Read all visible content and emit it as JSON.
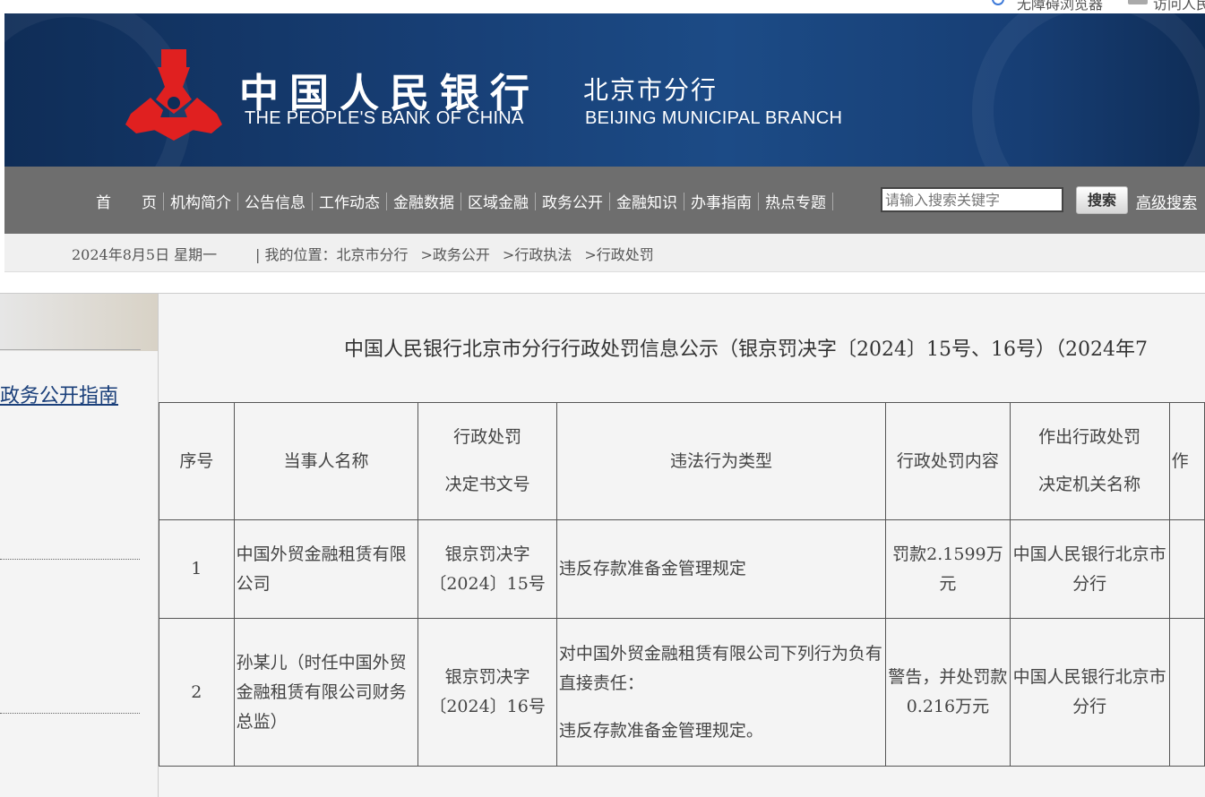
{
  "topbar": {
    "accessibility_browser": "无障碍浏览器",
    "visit_link": "访问人民"
  },
  "header": {
    "cn_name": "中国人民银行",
    "en_name": "THE PEOPLE'S BANK OF CHINA",
    "branch_cn": "北京市分行",
    "branch_en": "BEIJING MUNICIPAL  BRANCH",
    "logo_color": "#e02020"
  },
  "nav": {
    "items": [
      "首　　页",
      "机构简介",
      "公告信息",
      "工作动态",
      "金融数据",
      "区域金融",
      "政务公开",
      "金融知识",
      "办事指南",
      "热点专题"
    ],
    "search_placeholder": "请输入搜索关键字",
    "search_button": "搜索",
    "advanced_search": "高级搜索"
  },
  "breadcrumb": {
    "date": "2024年8月5日  星期一",
    "prefix": "| 我的位置：",
    "items": [
      "北京市分行",
      "政务公开",
      "行政执法",
      "行政处罚"
    ],
    "separator": ">"
  },
  "sidebar": {
    "guide_link": "政务公开指南"
  },
  "content": {
    "title": "中国人民银行北京市分行行政处罚信息公示（银京罚决字〔2024〕15号、16号）（2024年7",
    "table": {
      "headers": {
        "seq": "序号",
        "party": "当事人名称",
        "doc_no_line1": "行政处罚",
        "doc_no_line2": "决定书文号",
        "violation": "违法行为类型",
        "penalty": "行政处罚内容",
        "authority_line1": "作出行政处罚",
        "authority_line2": "决定机关名称",
        "date_partial": "作"
      },
      "rows": [
        {
          "seq": "1",
          "party": "中国外贸金融租赁有限公司",
          "doc_no": "银京罚决字〔2024〕15号",
          "violation_line1": "违反存款准备金管理规定",
          "violation_line2": "",
          "penalty": "罚款2.1599万元",
          "authority": "中国人民银行北京市分行"
        },
        {
          "seq": "2",
          "party": "孙某儿（时任中国外贸金融租赁有限公司财务总监）",
          "doc_no": "银京罚决字〔2024〕16号",
          "violation_line1": "对中国外贸金融租赁有限公司下列行为负有直接责任：",
          "violation_line2": "违反存款准备金管理规定。",
          "penalty": "警告，并处罚款0.216万元",
          "authority": "中国人民银行北京市分行"
        }
      ]
    }
  }
}
